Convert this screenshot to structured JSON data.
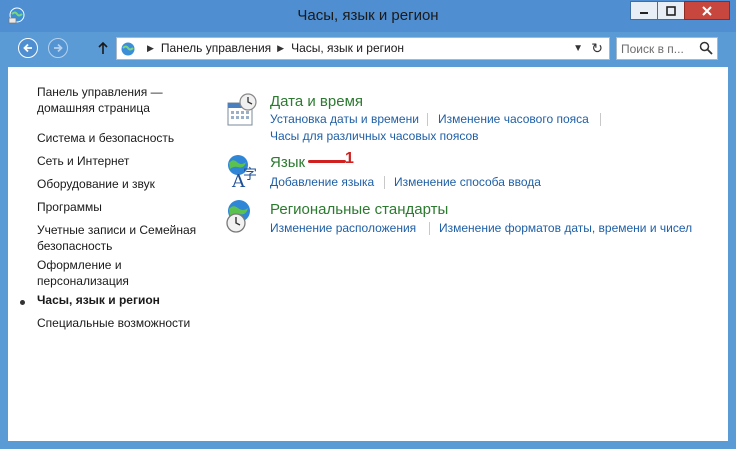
{
  "window": {
    "title": "Часы, язык и регион"
  },
  "address": {
    "crumbs": [
      "Панель управления",
      "Часы, язык и регион"
    ],
    "search_placeholder": "Поиск в п..."
  },
  "sidebar": {
    "items": [
      {
        "label_line1": "Панель управления —",
        "label_line2": "домашняя страница"
      },
      {
        "label": "Система и безопасность"
      },
      {
        "label": "Сеть и Интернет"
      },
      {
        "label": "Оборудование и звук"
      },
      {
        "label": "Программы"
      },
      {
        "label_line1": "Учетные записи и Семейная",
        "label_line2": "безопасность"
      },
      {
        "label_line1": "Оформление и",
        "label_line2": "персонализация"
      },
      {
        "label": "Часы, язык и регион"
      },
      {
        "label": "Специальные возможности"
      }
    ]
  },
  "categories": [
    {
      "title": "Дата и время",
      "links": [
        "Установка даты и времени",
        "Изменение часового пояса",
        "Часы для различных часовых поясов"
      ]
    },
    {
      "title": "Язык",
      "links": [
        "Добавление языка",
        "Изменение способа ввода"
      ]
    },
    {
      "title": "Региональные стандарты",
      "links": [
        "Изменение расположения",
        "Изменение форматов даты, времени и чисел"
      ]
    }
  ],
  "annotation": {
    "number": "1",
    "color": "#d02020"
  },
  "colors": {
    "category_title": "#2c7a30",
    "link": "#1f5fa6",
    "frame": "#5b9bd5"
  }
}
